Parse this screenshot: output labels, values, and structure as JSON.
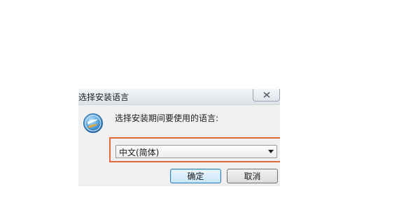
{
  "dialog": {
    "title": "选择安装语言",
    "prompt": "选择安装期间要使用的语言:",
    "language_select": {
      "selected": "中文(简体)"
    },
    "buttons": {
      "ok": "确定",
      "cancel": "取消"
    },
    "icons": {
      "app": "setup-wizard-icon",
      "close": "close-icon",
      "dropdown": "chevron-down-icon"
    }
  },
  "colors": {
    "highlight": "#e06a3a",
    "ok_border": "#3c7fb1",
    "window_bg": "#f0f0f0"
  }
}
